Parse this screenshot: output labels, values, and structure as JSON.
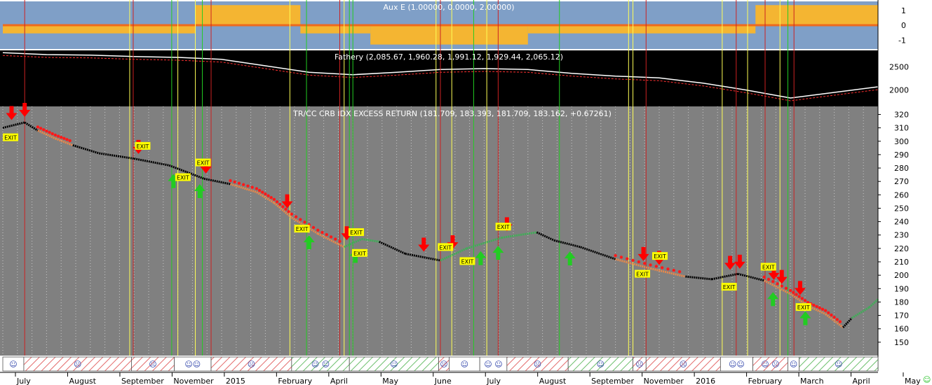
{
  "chart_data": [
    {
      "type": "area",
      "title": "Aux E (1.00000, 0.0000, 2.00000)",
      "y_ticks": [
        "1",
        "0",
        "-1"
      ],
      "ylim": [
        -1.6,
        1.6
      ],
      "colors": {
        "background": "#7f9fc7",
        "fill": "#f4b532",
        "flag": "#ee6a1d"
      },
      "segments": [
        {
          "from": 0.0,
          "to": 0.22,
          "value": -0.55
        },
        {
          "from": 0.22,
          "to": 0.34,
          "value": 1.35
        },
        {
          "from": 0.34,
          "to": 0.42,
          "value": -0.55
        },
        {
          "from": 0.42,
          "to": 0.6,
          "value": -1.3
        },
        {
          "from": 0.6,
          "to": 0.86,
          "value": -0.55
        },
        {
          "from": 0.86,
          "to": 1.0,
          "value": 1.35
        }
      ]
    },
    {
      "type": "line",
      "title": "Fathery (2,085.67, 1,960.28, 1,991.12, 1,929.44, 2,065.12)",
      "y_ticks": [
        2500,
        2000
      ],
      "ylim": [
        1650,
        2850
      ],
      "colors": {
        "background": "#000000",
        "price": "#ffffff",
        "band": "#ff3030"
      },
      "series": [
        {
          "x": [
            0.0,
            0.05,
            0.1,
            0.15,
            0.2,
            0.25,
            0.3,
            0.35,
            0.4,
            0.45,
            0.5,
            0.55,
            0.6,
            0.65,
            0.7,
            0.75,
            0.8,
            0.85,
            0.9,
            0.95,
            1.0
          ],
          "values": [
            2800,
            2760,
            2750,
            2720,
            2700,
            2660,
            2520,
            2380,
            2330,
            2380,
            2440,
            2460,
            2440,
            2360,
            2300,
            2260,
            2150,
            2000,
            1830,
            1950,
            2070
          ]
        }
      ]
    },
    {
      "type": "line",
      "title": "TR/CC CRB IDX EXCESS RETURN (181.709, 183.393, 181.709, 183.162, +0.67261)",
      "y_ticks": [
        320,
        310,
        300,
        290,
        280,
        270,
        260,
        250,
        240,
        230,
        220,
        210,
        200,
        190,
        180,
        170,
        160,
        150
      ],
      "ylim": [
        140,
        326
      ],
      "x_labels": [
        "July",
        "August",
        "September",
        "November",
        "2015",
        "February",
        "April",
        "May",
        "June",
        "July",
        "August",
        "September",
        "November",
        "2016",
        "February",
        "March",
        "April",
        "May"
      ],
      "colors": {
        "background": "#808080",
        "neutral": "#000000",
        "down": "#e8884a",
        "up": "#3fae57",
        "down_dots": "#ff1a1a",
        "arrow_down": "#ff0000",
        "arrow_up": "#22cc22",
        "exit_box": "#ffff00",
        "band_neutral": "#ffffff",
        "band_down": "#e36b6b",
        "band_up": "#6dbf6d",
        "vline_red": "#cc2222",
        "vline_green": "#22cc22",
        "vline_yellow": "#ffff55"
      },
      "series": [
        {
          "name": "price",
          "x": [
            0.0,
            0.025,
            0.04,
            0.06,
            0.08,
            0.11,
            0.15,
            0.19,
            0.21,
            0.23,
            0.26,
            0.29,
            0.31,
            0.33,
            0.36,
            0.39,
            0.41,
            0.43,
            0.46,
            0.5,
            0.53,
            0.57,
            0.61,
            0.63,
            0.66,
            0.7,
            0.74,
            0.78,
            0.81,
            0.84,
            0.87,
            0.9,
            0.92,
            0.94,
            0.96,
            0.97,
            0.99,
            1.0
          ],
          "values": [
            310,
            314,
            308,
            302,
            297,
            291,
            287,
            282,
            277,
            272,
            268,
            262,
            254,
            243,
            231,
            221,
            227,
            225,
            216,
            211,
            220,
            228,
            232,
            226,
            221,
            212,
            205,
            199,
            197,
            201,
            196,
            186,
            177,
            171,
            161,
            168,
            176,
            182
          ],
          "trend": [
            "neutral",
            "neutral",
            "down",
            "down",
            "neutral",
            "neutral",
            "neutral",
            "neutral",
            "neutral",
            "neutral",
            "down",
            "down",
            "down",
            "down",
            "down",
            "up",
            "up",
            "neutral",
            "neutral",
            "up",
            "up",
            "up",
            "neutral",
            "neutral",
            "neutral",
            "down",
            "down",
            "neutral",
            "neutral",
            "neutral",
            "down",
            "down",
            "down",
            "down",
            "neutral",
            "up",
            "up",
            "up"
          ]
        }
      ],
      "signals": {
        "down_arrows": [
          0.01,
          0.025,
          0.155,
          0.232,
          0.325,
          0.393,
          0.481,
          0.514,
          0.576,
          0.732,
          0.75,
          0.831,
          0.842,
          0.881,
          0.89,
          0.911
        ],
        "up_arrows": [
          0.195,
          0.225,
          0.35,
          0.403,
          0.546,
          0.566,
          0.648,
          0.88,
          0.917
        ],
        "exit_labels": [
          0.0,
          0.151,
          0.197,
          0.22,
          0.333,
          0.395,
          0.399,
          0.497,
          0.522,
          0.563,
          0.722,
          0.742,
          0.821,
          0.866,
          0.906
        ],
        "exit_text": "EXIT"
      },
      "regime_bands": [
        {
          "from": 0.0,
          "to": 0.024,
          "kind": "neutral",
          "face": "☺"
        },
        {
          "from": 0.024,
          "to": 0.147,
          "kind": "down",
          "face": "☹"
        },
        {
          "from": 0.147,
          "to": 0.196,
          "kind": "down",
          "face": "☹"
        },
        {
          "from": 0.196,
          "to": 0.238,
          "kind": "neutral",
          "face": "☺☺"
        },
        {
          "from": 0.238,
          "to": 0.33,
          "kind": "down",
          "face": "☹"
        },
        {
          "from": 0.33,
          "to": 0.396,
          "kind": "up",
          "face": "☺ ☺"
        },
        {
          "from": 0.396,
          "to": 0.498,
          "kind": "up",
          "face": "☺"
        },
        {
          "from": 0.498,
          "to": 0.51,
          "kind": "down",
          "face": "☹"
        },
        {
          "from": 0.51,
          "to": 0.545,
          "kind": "neutral",
          "face": "☺"
        },
        {
          "from": 0.545,
          "to": 0.576,
          "kind": "neutral",
          "face": "☺ ☺"
        },
        {
          "from": 0.576,
          "to": 0.646,
          "kind": "down",
          "face": "☹"
        },
        {
          "from": 0.646,
          "to": 0.72,
          "kind": "up",
          "face": "☺"
        },
        {
          "from": 0.72,
          "to": 0.735,
          "kind": "down",
          "face": "☹"
        },
        {
          "from": 0.735,
          "to": 0.82,
          "kind": "down",
          "face": "☹"
        },
        {
          "from": 0.82,
          "to": 0.857,
          "kind": "neutral",
          "face": "☺☺"
        },
        {
          "from": 0.857,
          "to": 0.897,
          "kind": "down",
          "face": "☺ ☹"
        },
        {
          "from": 0.897,
          "to": 0.91,
          "kind": "neutral",
          "face": "☺"
        },
        {
          "from": 0.91,
          "to": 1.0,
          "kind": "up",
          "face": "☺"
        }
      ],
      "vertical_lines": [
        {
          "x": 0.025,
          "color": "red"
        },
        {
          "x": 0.145,
          "color": "yellow"
        },
        {
          "x": 0.149,
          "color": "red"
        },
        {
          "x": 0.193,
          "color": "green"
        },
        {
          "x": 0.2,
          "color": "yellow"
        },
        {
          "x": 0.22,
          "color": "yellow"
        },
        {
          "x": 0.228,
          "color": "green"
        },
        {
          "x": 0.238,
          "color": "red"
        },
        {
          "x": 0.328,
          "color": "yellow"
        },
        {
          "x": 0.347,
          "color": "green"
        },
        {
          "x": 0.385,
          "color": "red"
        },
        {
          "x": 0.39,
          "color": "yellow"
        },
        {
          "x": 0.396,
          "color": "green"
        },
        {
          "x": 0.4,
          "color": "green"
        },
        {
          "x": 0.495,
          "color": "yellow"
        },
        {
          "x": 0.5,
          "color": "red"
        },
        {
          "x": 0.513,
          "color": "yellow"
        },
        {
          "x": 0.538,
          "color": "green"
        },
        {
          "x": 0.553,
          "color": "yellow"
        },
        {
          "x": 0.566,
          "color": "red"
        },
        {
          "x": 0.636,
          "color": "green"
        },
        {
          "x": 0.715,
          "color": "yellow"
        },
        {
          "x": 0.72,
          "color": "yellow"
        },
        {
          "x": 0.735,
          "color": "red"
        },
        {
          "x": 0.822,
          "color": "yellow"
        },
        {
          "x": 0.838,
          "color": "red"
        },
        {
          "x": 0.851,
          "color": "yellow"
        },
        {
          "x": 0.871,
          "color": "red"
        },
        {
          "x": 0.888,
          "color": "yellow"
        },
        {
          "x": 0.897,
          "color": "green"
        },
        {
          "x": 0.904,
          "color": "red"
        }
      ]
    }
  ],
  "footer": {
    "status_icon": "smiley-icon",
    "status_glyph": "☺"
  }
}
